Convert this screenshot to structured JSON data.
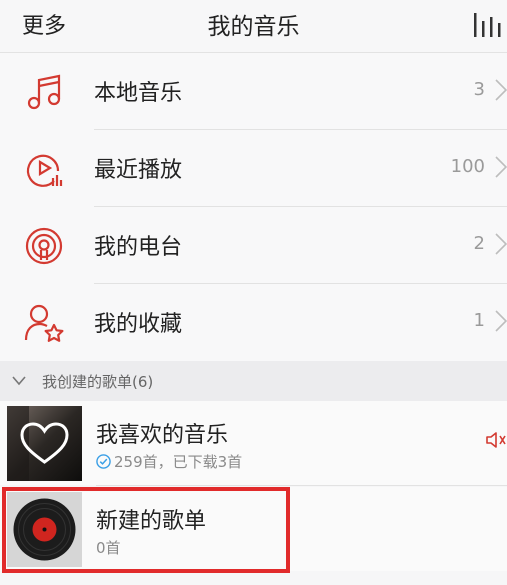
{
  "header": {
    "left_label": "更多",
    "title": "我的音乐",
    "right_icon": "now-playing-bars-icon"
  },
  "menu": {
    "items": [
      {
        "label": "本地音乐",
        "count": "3",
        "icon": "music-note-icon"
      },
      {
        "label": "最近播放",
        "count": "100",
        "icon": "recent-play-icon"
      },
      {
        "label": "我的电台",
        "count": "2",
        "icon": "radio-podcast-icon"
      },
      {
        "label": "我的收藏",
        "count": "1",
        "icon": "user-star-icon"
      }
    ]
  },
  "section": {
    "title": "我创建的歌单(6)"
  },
  "playlists": [
    {
      "name": "我喜欢的音乐",
      "sub": "259首，已下载3首",
      "icon": "heart-cover-icon"
    },
    {
      "name": "新建的歌单",
      "sub": "0首",
      "icon": "vinyl-record-icon"
    }
  ],
  "colors": {
    "accent": "#d33a31",
    "highlight": "#e12b2b",
    "download_check": "#3a9fe6"
  }
}
